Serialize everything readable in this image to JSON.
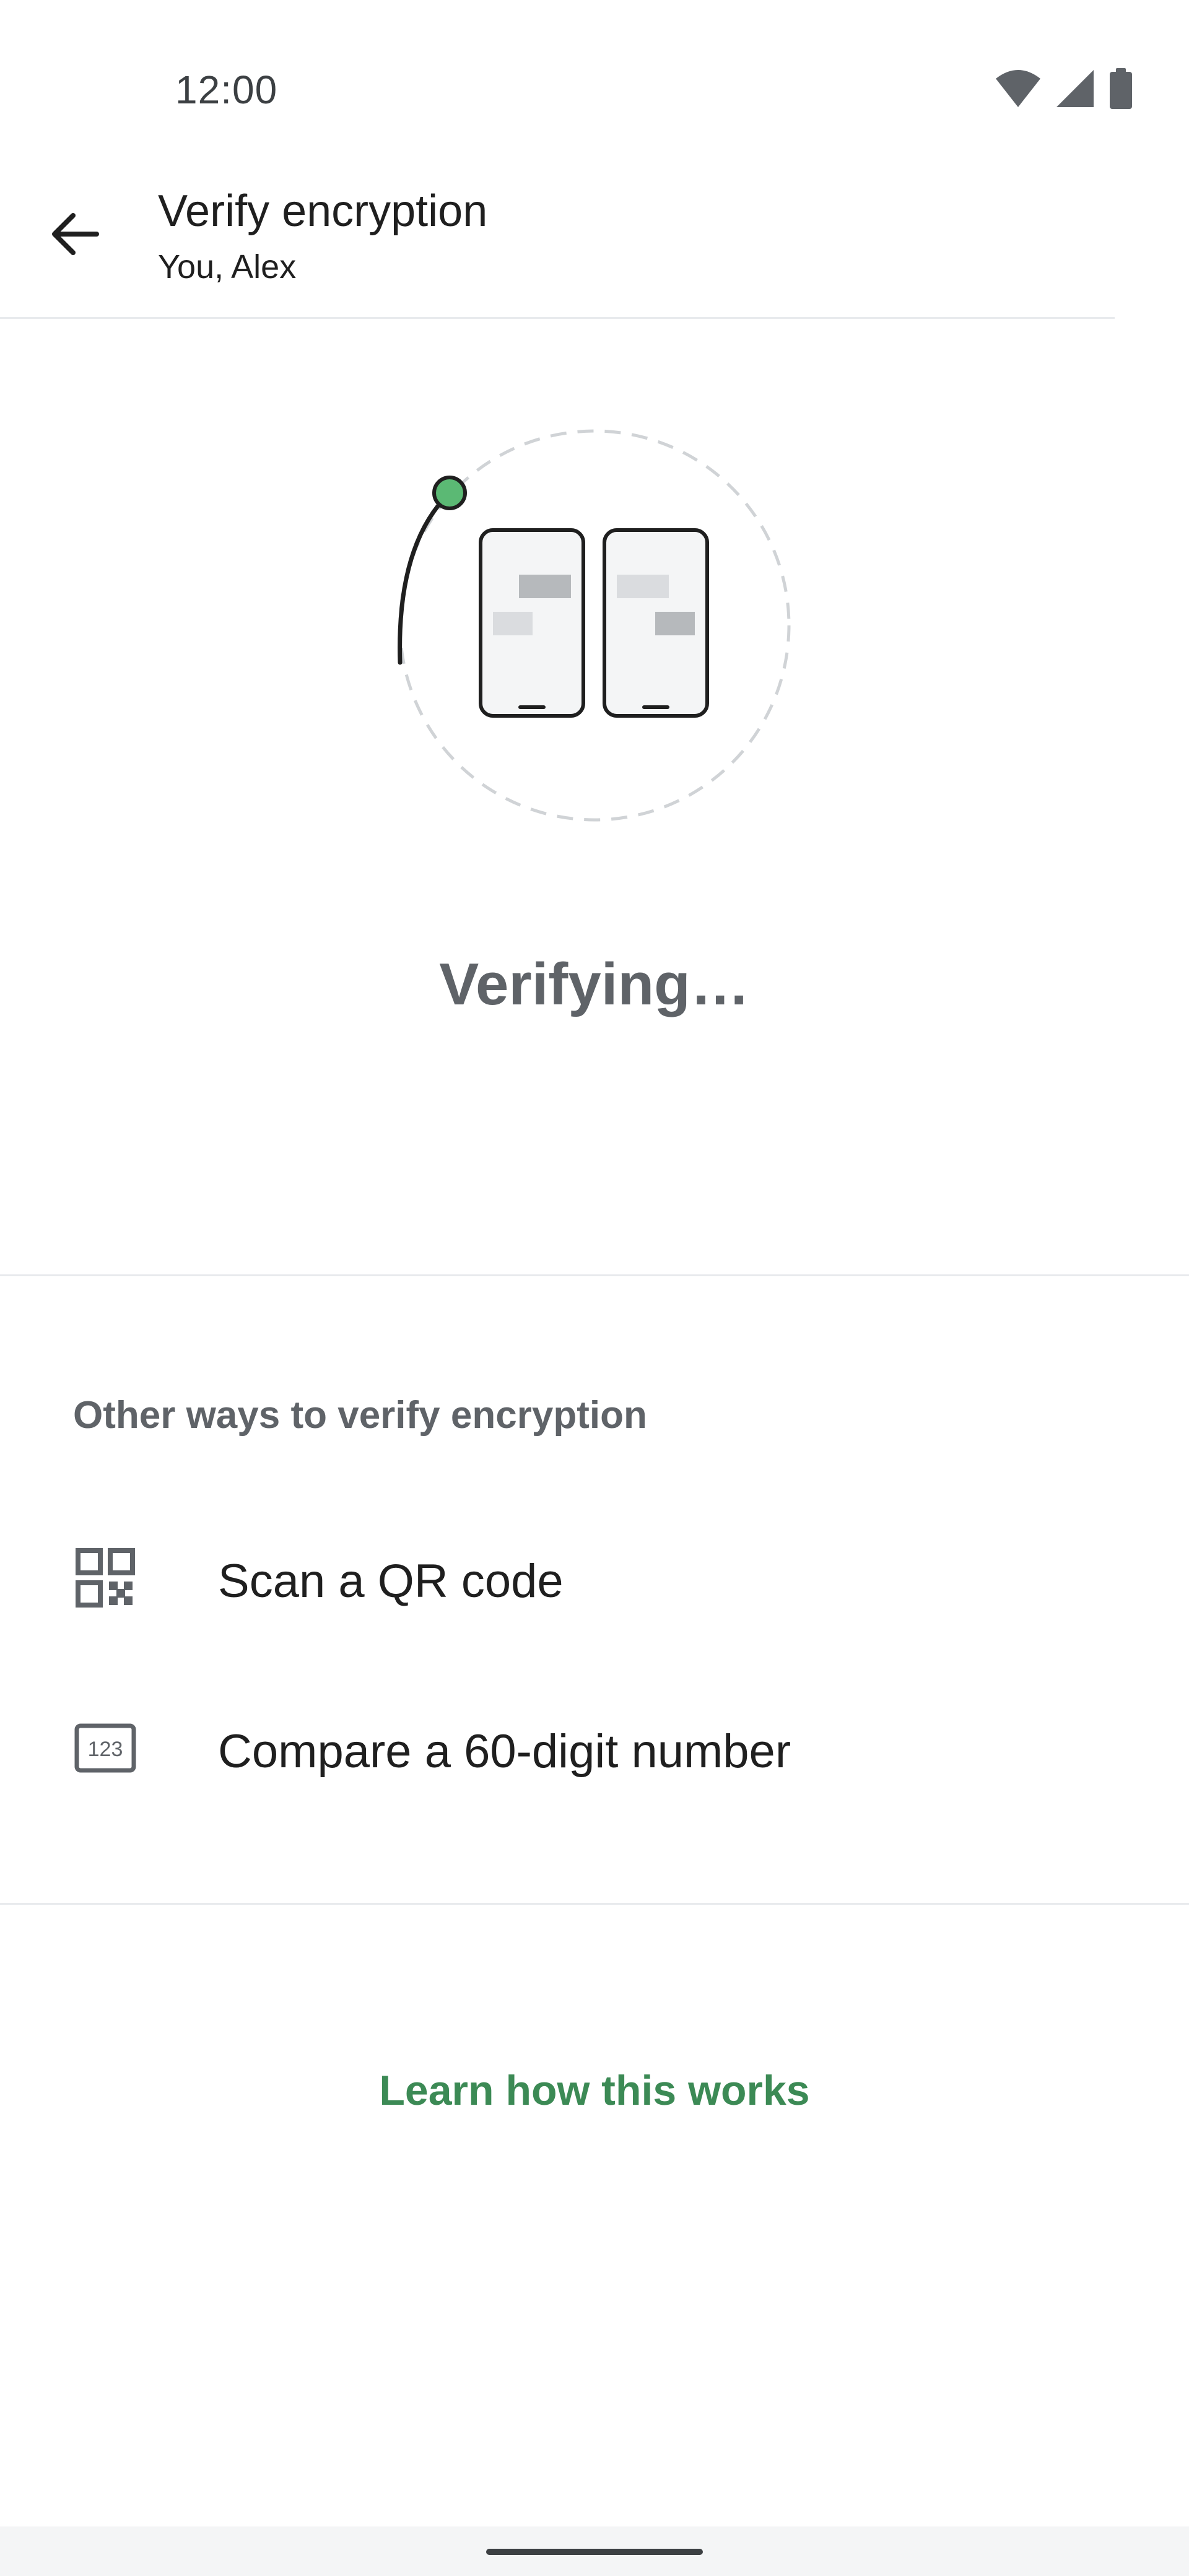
{
  "status_bar": {
    "time": "12:00",
    "icons": [
      "wifi-icon",
      "signal-icon",
      "battery-icon"
    ]
  },
  "app_bar": {
    "back_icon": "arrow-back-icon",
    "title": "Verify encryption",
    "subtitle": "You, Alex"
  },
  "illustration": {
    "icon": "two-phones-verification-illustration",
    "accent_color": "#5bb974"
  },
  "status_text": "Verifying…",
  "other_ways": {
    "heading": "Other ways to verify encryption",
    "options": [
      {
        "icon": "qr-code-icon",
        "label": "Scan a QR code"
      },
      {
        "icon": "number-123-icon",
        "label": "Compare a 60-digit number"
      }
    ]
  },
  "learn_link": "Learn how this works",
  "colors": {
    "link": "#3c8a55",
    "secondary_text": "#5f6368",
    "primary_text": "#1f1f1f"
  }
}
